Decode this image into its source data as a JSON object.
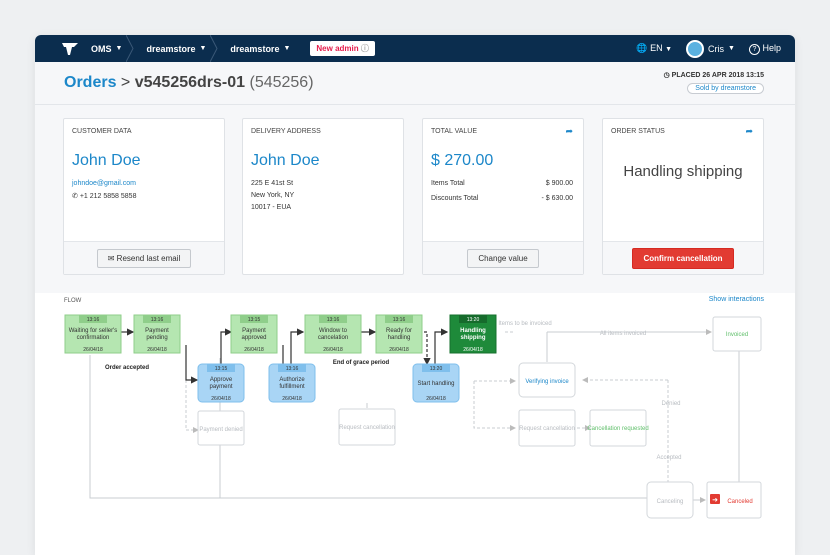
{
  "topbar": {
    "oms": "OMS",
    "store1": "dreamstore",
    "store2": "dreamstore",
    "new_admin": "New admin",
    "lang": "EN",
    "user": "Cris",
    "help": "Help"
  },
  "header": {
    "orders": "Orders",
    "order_id": "v545256drs-01",
    "order_num": "(545256)",
    "placed": "PLACED 26 APR 2018 13:15",
    "sold_by": "Sold by dreamstore"
  },
  "cards": {
    "customer": {
      "label": "CUSTOMER DATA",
      "name": "John Doe",
      "email": "johndoe@gmail.com",
      "phone": "+1 212 5858 5858",
      "button": "Resend last email"
    },
    "delivery": {
      "label": "DELIVERY ADDRESS",
      "name": "John Doe",
      "line1": "225 E 41st St",
      "line2": "New York, NY",
      "line3": "10017 - EUA"
    },
    "total": {
      "label": "TOTAL VALUE",
      "value": "$ 270.00",
      "items_label": "Items Total",
      "items_value": "$ 900.00",
      "discounts_label": "Discounts Total",
      "discounts_value": "- $ 630.00",
      "button": "Change value"
    },
    "status": {
      "label": "ORDER STATUS",
      "value": "Handling shipping",
      "button": "Confirm cancellation"
    }
  },
  "flow": {
    "label": "FLOW",
    "show_interactions": "Show interactions",
    "order_accepted": "Order accepted",
    "end_grace": "End of grace period",
    "nodes": [
      {
        "id": "waiting",
        "time": "13:16",
        "l1": "Waiting for seller's",
        "l2": "confirmation",
        "date": "26/04/18"
      },
      {
        "id": "payment-pending",
        "time": "13:16",
        "l1": "Payment",
        "l2": "pending",
        "date": "26/04/18"
      },
      {
        "id": "payment-approved",
        "time": "13:15",
        "l1": "Payment",
        "l2": "approved",
        "date": "26/04/18"
      },
      {
        "id": "window-cancel",
        "time": "13:16",
        "l1": "Window to",
        "l2": "cancelation",
        "date": "26/04/18"
      },
      {
        "id": "ready-handling",
        "time": "13:16",
        "l1": "Ready for",
        "l2": "handling",
        "date": "26/04/18"
      },
      {
        "id": "handling-shipping",
        "time": "13:20",
        "l1": "Handling",
        "l2": "shipping",
        "date": "26/04/18"
      },
      {
        "id": "approve-payment",
        "time": "13:15",
        "l1": "Approve",
        "l2": "payment",
        "date": "26/04/18"
      },
      {
        "id": "authorize-fulfillment",
        "time": "13:16",
        "l1": "Authorize",
        "l2": "fulfillment",
        "date": "26/04/18"
      },
      {
        "id": "start-handling",
        "time": "13:20",
        "l1": "Start handling",
        "l2": "",
        "date": "26/04/18"
      }
    ],
    "pending": {
      "items_invoiced": "Items to be invoiced",
      "all_invoiced": "All items invoiced",
      "invoiced": "Invoiced",
      "verifying": "Verifying invoice",
      "payment_denied": "Payment denied",
      "request_cancel1": "Request cancellation",
      "request_cancel2": "Request cancellation",
      "cancel_requested": "Cancellation requested",
      "denied": "Denied",
      "accepted": "Accepted",
      "canceling": "Canceling",
      "canceled": "Canceled"
    }
  },
  "colors": {
    "topbar": "#0b2d4e",
    "accent": "#1c87c9",
    "green_light": "#b5e6b1",
    "green_dark": "#1e8a3a",
    "blue_light": "#a9d5f5",
    "red": "#e23b32"
  }
}
